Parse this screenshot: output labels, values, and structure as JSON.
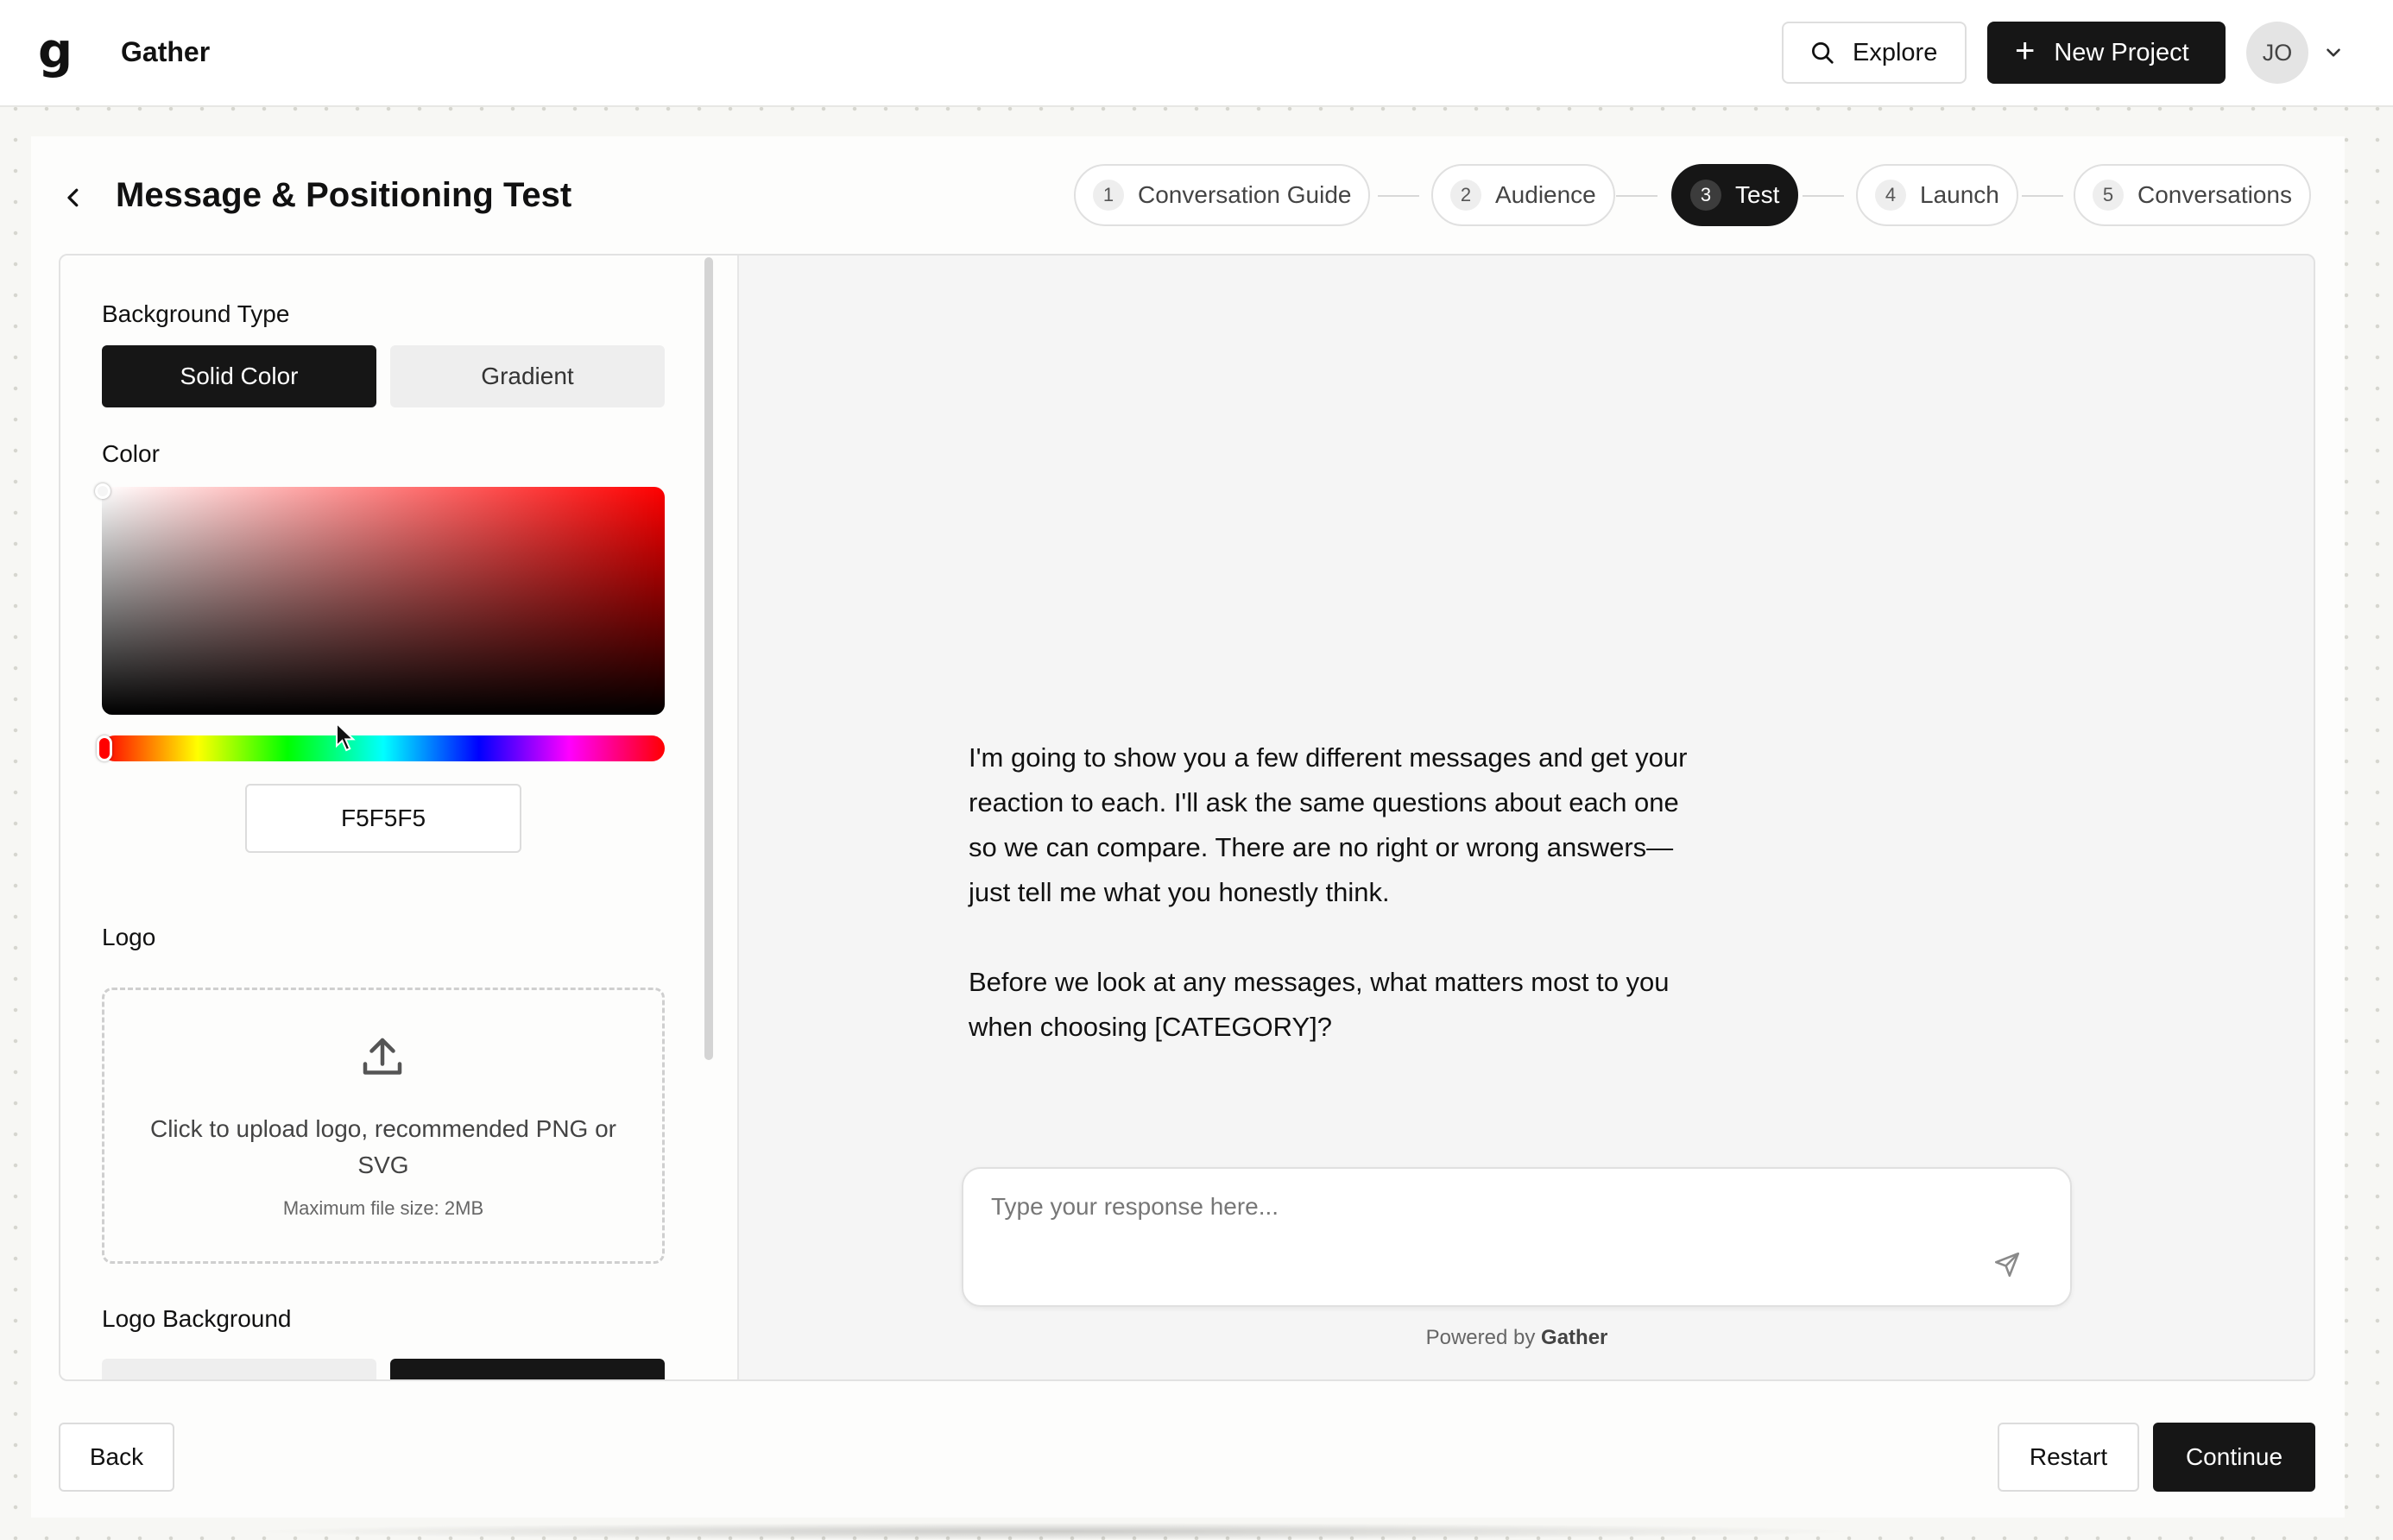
{
  "app": {
    "name": "Gather",
    "logo_glyph": "g"
  },
  "header": {
    "explore_label": "Explore",
    "new_project_label": "New Project",
    "avatar_initials": "JO"
  },
  "page": {
    "title": "Message & Positioning Test"
  },
  "steps": [
    {
      "num": "1",
      "label": "Conversation Guide",
      "active": false
    },
    {
      "num": "2",
      "label": "Audience",
      "active": false
    },
    {
      "num": "3",
      "label": "Test",
      "active": true
    },
    {
      "num": "4",
      "label": "Launch",
      "active": false
    },
    {
      "num": "5",
      "label": "Conversations",
      "active": false
    }
  ],
  "settings": {
    "background_type_label": "Background Type",
    "solid_label": "Solid Color",
    "gradient_label": "Gradient",
    "color_label": "Color",
    "hex_value": "F5F5F5",
    "logo_label": "Logo",
    "upload_text": "Click to upload logo, recommended PNG or SVG",
    "upload_sub": "Maximum file size: 2MB",
    "logo_background_label": "Logo Background"
  },
  "preview": {
    "message_p1": "I'm going to show you a few different messages and get your reaction to each. I'll ask the same questions about each one so we can compare. There are no right or wrong answers—just tell me what you honestly think.",
    "message_p2": "Before we look at any messages, what matters most to you when choosing [CATEGORY]?",
    "response_placeholder": "Type your response here...",
    "powered_prefix": "Powered by",
    "powered_brand": "Gather"
  },
  "footer": {
    "back_label": "Back",
    "restart_label": "Restart",
    "continue_label": "Continue"
  },
  "colors": {
    "accent": "#161616",
    "preview_background": "#F5F5F5"
  }
}
